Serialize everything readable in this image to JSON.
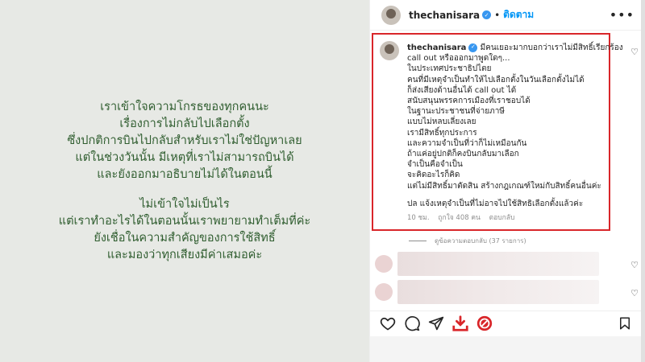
{
  "image_text": {
    "paragraph1": [
      "เราเข้าใจความโกรธของทุกคนนะ",
      "เรื่องการไม่กลับไปเลือกตั้ง",
      "ซึ่งปกติการบินไปกลับสำหรับเราไม่ใช่ปัญหาเลย",
      "แต่ในช่วงวันนั้น มีเหตุที่เราไม่สามารถบินได้",
      "และยังออกมาอธิบายไม่ได้ในตอนนี้"
    ],
    "paragraph2": [
      "ไม่เข้าใจไม่เป็นไร",
      "แต่เราทำอะไรได้ในตอนนั้นเราพยายามทำเต็มที่ค่ะ",
      "ยังเชื่อในความสำคัญของการใช้สิทธิ์",
      "และมองว่าทุกเสียงมีค่าเสมอค่ะ"
    ]
  },
  "header": {
    "username": "thechanisara",
    "separator": "•",
    "follow_label": "ติดตาม",
    "more_icon": "more-horizontal-icon"
  },
  "comment": {
    "username": "thechanisara",
    "first_line": "มีคนเยอะมากบอกว่าเราไม่มีสิทธิ์เรียกร้อง",
    "lines": [
      "call out หรือออกมาพูดใดๆ...",
      "ในประเทศประชาธิปไตย",
      "คนที่มีเหตุจำเป็นทำให้ไปเลือกตั้งในวันเลือกตั้งไม่ได้",
      "ก็ส่งเสียงด้านอื่นได้ call out ได้",
      "สนับสนุนพรรคการเมืองที่เราชอบได้",
      "ในฐานะประชาชนที่จ่ายภาษี",
      "แบบไม่หลบเลี่ยงเลย",
      "เรามีสิทธิ์ทุกประการ",
      "และความจำเป็นที่ว่าก็ไม่เหมือนกัน",
      "ถ้าแค่อยู่ปกติก็คงบินกลับมาเลือก",
      "จำเป็นคือจำเป็น",
      "จะคิดอะไรก็คิด",
      "แต่ไม่มีสิทธิ์มาตัดสิน สร้างกฎเกณฑ์ใหม่กับสิทธิ์คนอื่นค่ะ"
    ],
    "ps_line": "ปล แจ้งเหตุจำเป็นที่ไม่อาจไปใช้สิทธิเลือกตั้งแล้วค่ะ",
    "time": "10 ชม.",
    "likes": "ถูกใจ 408 คน",
    "reply": "ตอบกลับ"
  },
  "replies_label": "ดูข้อความตอบกลับ (37 รายการ)",
  "actions": {
    "like": "heart-icon",
    "comment": "comment-icon",
    "share": "send-icon",
    "download": "download-icon",
    "extra": "extension-icon",
    "save": "bookmark-icon"
  }
}
